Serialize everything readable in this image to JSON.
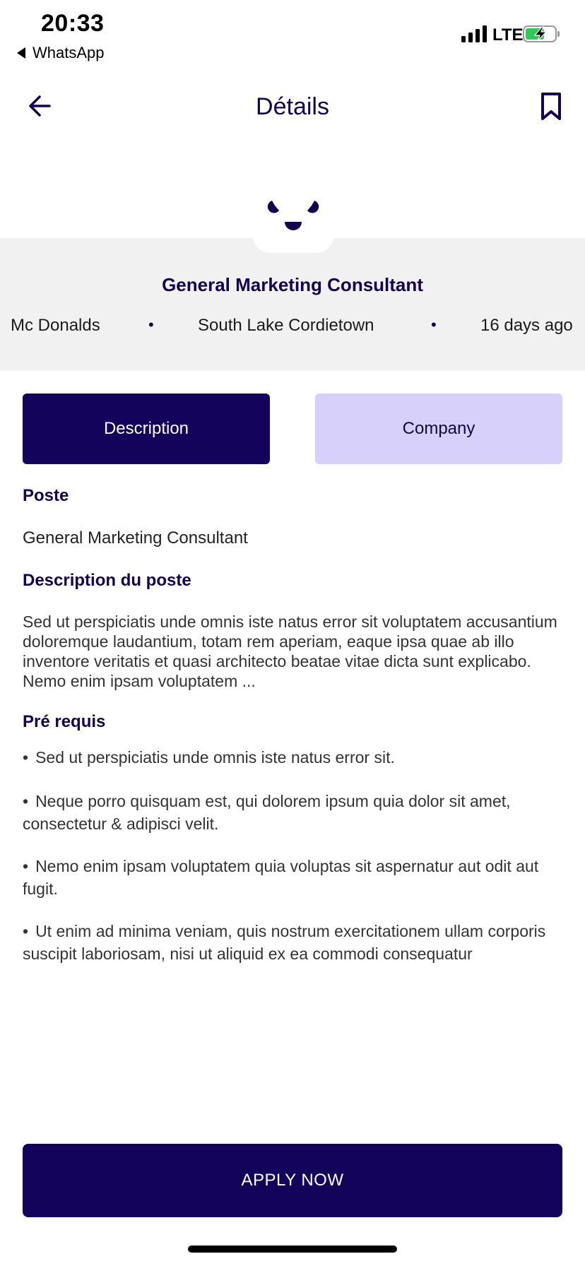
{
  "status_bar": {
    "time": "20:33",
    "back_app": "WhatsApp",
    "network": "LTE",
    "icons": [
      "signal-icon",
      "battery-charging-icon"
    ]
  },
  "nav": {
    "title": "Détails",
    "icons": [
      "arrow-left-icon",
      "bookmark-icon"
    ]
  },
  "job": {
    "title": "General Marketing Consultant",
    "company": "Mc Donalds",
    "location": "South Lake Cordietown",
    "posted": "16 days ago",
    "separator": "•"
  },
  "tabs": [
    {
      "label": "Description",
      "active": true
    },
    {
      "label": "Company",
      "active": false
    }
  ],
  "content": {
    "poste_heading": "Poste",
    "poste_value": "General Marketing Consultant",
    "description_heading": "Description du poste",
    "description_text": "Sed ut perspiciatis unde omnis iste natus error sit voluptatem accusantium doloremque laudantium, totam rem aperiam, eaque ipsa quae ab illo inventore veritatis et quasi architecto beatae vitae dicta sunt explicabo. Nemo enim ipsam voluptatem ...",
    "requirements_heading": "Pré requis",
    "bullet_char": "•",
    "requirements": [
      "Sed ut perspiciatis unde omnis iste natus error sit.",
      "Neque porro quisquam est, qui dolorem ipsum quia dolor sit amet, consectetur & adipisci velit.",
      "Nemo enim ipsam voluptatem quia voluptas sit aspernatur aut odit aut fugit.",
      "Ut enim ad minima veniam, quis nostrum exercitationem ullam corporis suscipit laboriosam, nisi ut aliquid ex ea commodi consequatur"
    ]
  },
  "apply_button": "APPLY NOW",
  "colors": {
    "primary": "#14035a",
    "tab_inactive": "#d6d0fb",
    "header_band": "#f1f1f1"
  }
}
